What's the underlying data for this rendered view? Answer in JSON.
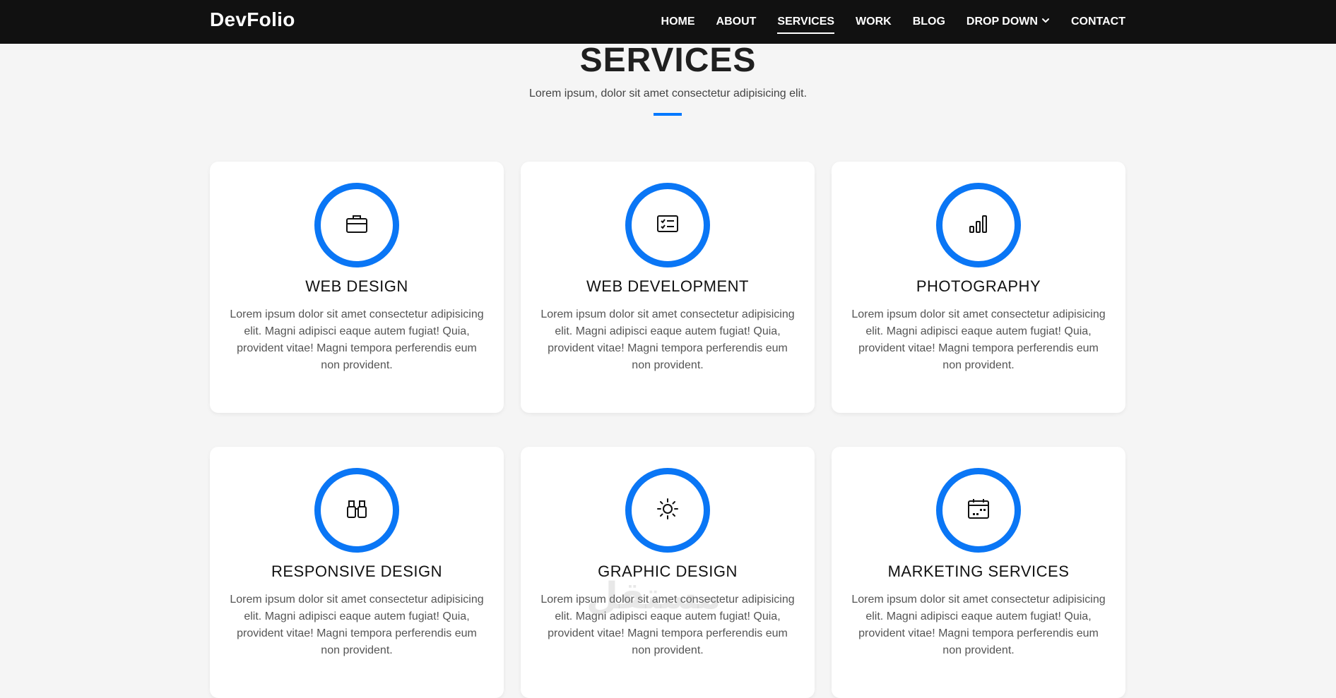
{
  "navbar": {
    "brand": "DevFolio",
    "items": [
      {
        "label": "HOME"
      },
      {
        "label": "ABOUT"
      },
      {
        "label": "SERVICES",
        "active": true
      },
      {
        "label": "WORK"
      },
      {
        "label": "BLOG"
      },
      {
        "label": "DROP DOWN",
        "icon": "chevron-down-icon"
      },
      {
        "label": "CONTACT"
      }
    ]
  },
  "section": {
    "title": "SERVICES",
    "subtitle": "Lorem ipsum, dolor sit amet consectetur adipisicing elit."
  },
  "services": [
    {
      "title": "WEB DESIGN",
      "icon": "briefcase-icon",
      "text": "Lorem ipsum dolor sit amet consectetur adipisicing elit. Magni adipisci eaque autem fugiat! Quia, provident vitae! Magni tempora perferendis eum non provident."
    },
    {
      "title": "WEB DEVELOPMENT",
      "icon": "card-checklist-icon",
      "text": "Lorem ipsum dolor sit amet consectetur adipisicing elit. Magni adipisci eaque autem fugiat! Quia, provident vitae! Magni tempora perferendis eum non provident."
    },
    {
      "title": "PHOTOGRAPHY",
      "icon": "bar-chart-icon",
      "text": "Lorem ipsum dolor sit amet consectetur adipisicing elit. Magni adipisci eaque autem fugiat! Quia, provident vitae! Magni tempora perferendis eum non provident."
    },
    {
      "title": "RESPONSIVE DESIGN",
      "icon": "binoculars-icon",
      "text": "Lorem ipsum dolor sit amet consectetur adipisicing elit. Magni adipisci eaque autem fugiat! Quia, provident vitae! Magni tempora perferendis eum non provident."
    },
    {
      "title": "GRAPHIC DESIGN",
      "icon": "brightness-icon",
      "text": "Lorem ipsum dolor sit amet consectetur adipisicing elit. Magni adipisci eaque autem fugiat! Quia, provident vitae! Magni tempora perferendis eum non provident."
    },
    {
      "title": "MARKETING SERVICES",
      "icon": "calendar-icon",
      "text": "Lorem ipsum dolor sit amet consectetur adipisicing elit. Magni adipisci eaque autem fugiat! Quia, provident vitae! Magni tempora perferendis eum non provident."
    }
  ],
  "colors": {
    "accent": "#0a76f5",
    "navbar_bg": "#111111",
    "page_bg": "#f5f5f5"
  },
  "watermark": "مستقل"
}
